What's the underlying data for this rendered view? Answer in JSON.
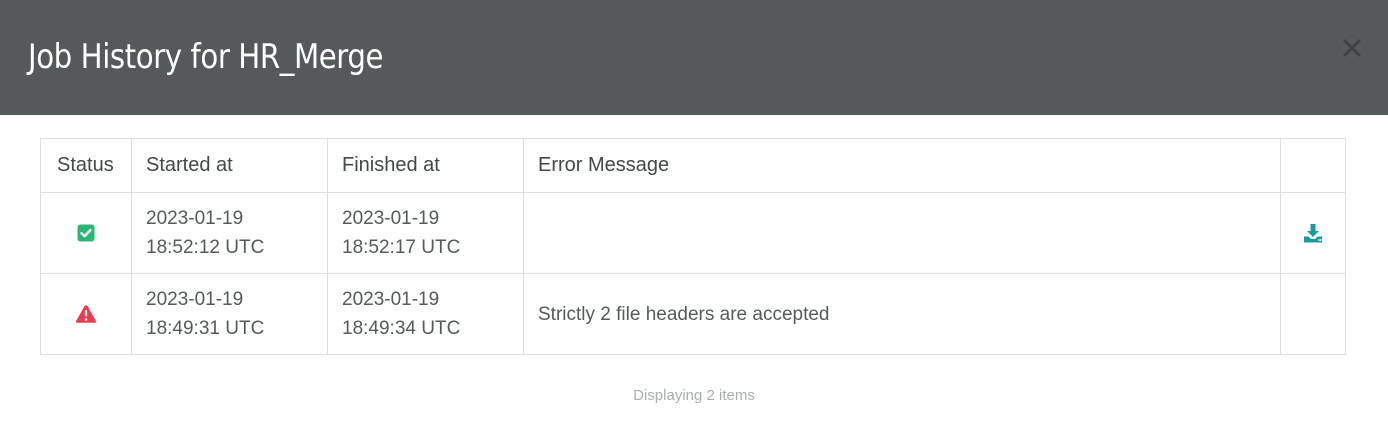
{
  "dialog": {
    "title": "Job History for HR_Merge",
    "close_icon": "close-icon"
  },
  "table": {
    "headers": {
      "status": "Status",
      "started_at": "Started at",
      "finished_at": "Finished at",
      "error_message": "Error Message",
      "actions": ""
    },
    "rows": [
      {
        "status": "success",
        "status_icon": "check-square-icon",
        "status_color": "#2bb673",
        "started_date": "2023-01-19",
        "started_time": "18:52:12 UTC",
        "finished_date": "2023-01-19",
        "finished_time": "18:52:17 UTC",
        "error_message": "",
        "action_icon": "download-icon",
        "action_color": "#1a9a9a"
      },
      {
        "status": "error",
        "status_icon": "warning-triangle-icon",
        "status_color": "#ee3b52",
        "started_date": "2023-01-19",
        "started_time": "18:49:31 UTC",
        "finished_date": "2023-01-19",
        "finished_time": "18:49:34 UTC",
        "error_message": "Strictly 2 file headers are accepted"
      }
    ]
  },
  "footer": {
    "summary": "Displaying 2 items"
  }
}
